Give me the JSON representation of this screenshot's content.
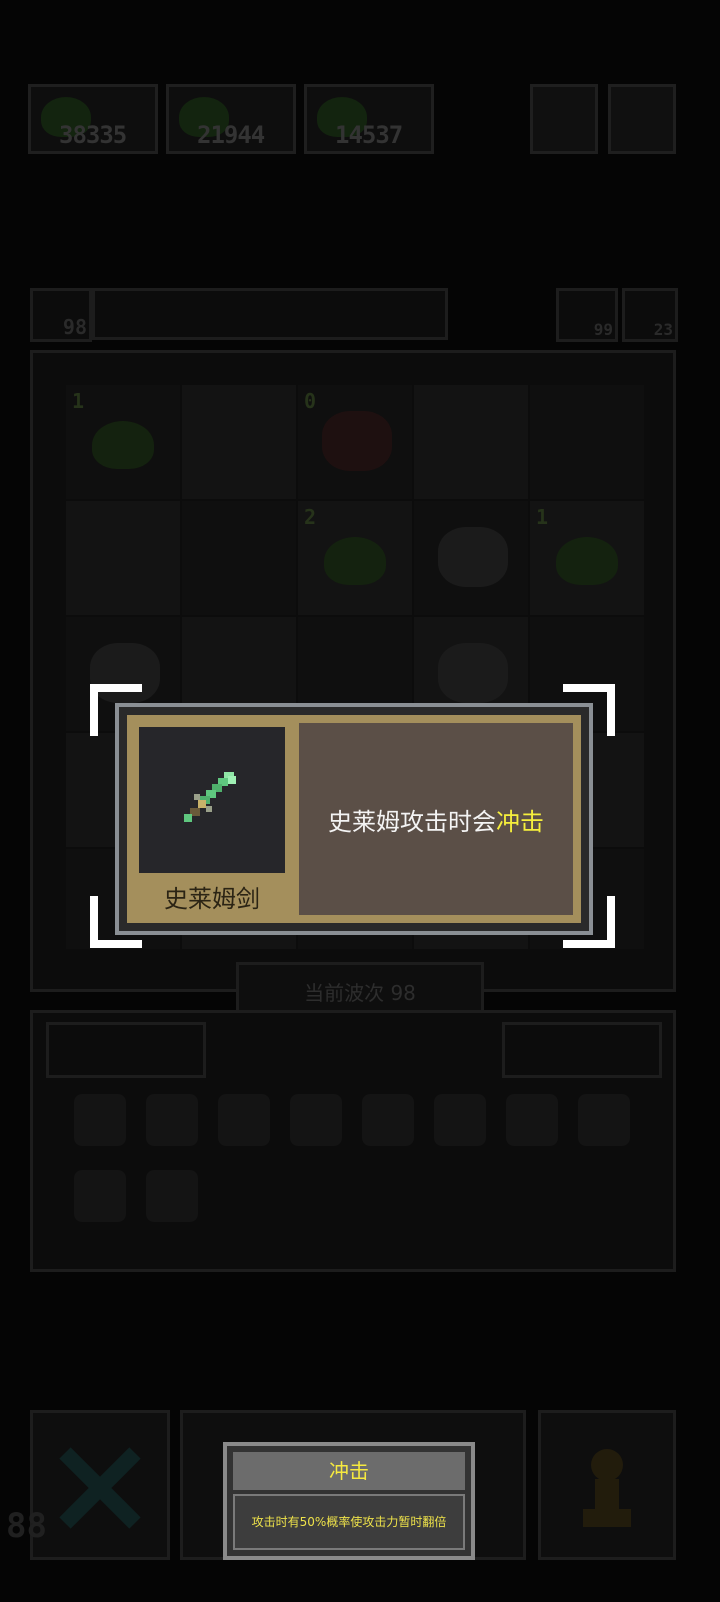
{
  "top_scores": [
    "38335",
    "21944",
    "14537"
  ],
  "status_bar": {
    "slime_count": "98",
    "house_count": "99",
    "bolt_count": "23"
  },
  "grid_cells": [
    {
      "level": "1",
      "content": "slime"
    },
    {
      "level": "",
      "content": "empty"
    },
    {
      "level": "0",
      "content": "bush"
    },
    {
      "level": "",
      "content": "empty"
    },
    {
      "level": "",
      "content": "empty"
    },
    {
      "level": "",
      "content": "empty"
    },
    {
      "level": "",
      "content": "empty"
    },
    {
      "level": "2",
      "content": "slime"
    },
    {
      "level": "",
      "content": "cloud"
    },
    {
      "level": "1",
      "content": "slime"
    }
  ],
  "wave_label": "当前波次 98",
  "bottom_corner_number": "88",
  "item_popup": {
    "item_name": "史莱姆剑",
    "description_prefix": "史莱姆攻击时会",
    "description_highlight": "冲击",
    "icon": "green-sword-icon"
  },
  "tooltip": {
    "title": "冲击",
    "body": "攻击时有50%概率使攻击力暂时翻倍"
  },
  "colors": {
    "highlight": "#f6ef3c",
    "popup_gold": "#a48f5c",
    "popup_desc_bg": "#5b4f47"
  }
}
